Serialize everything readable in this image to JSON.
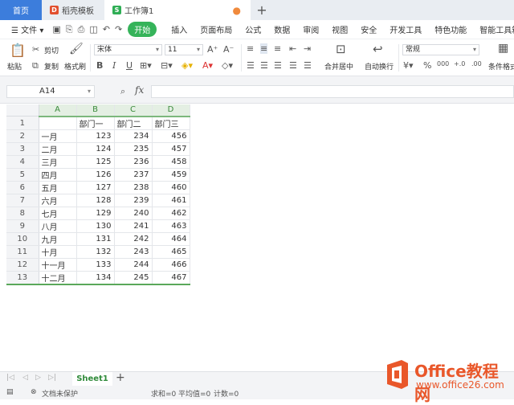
{
  "tabs": {
    "home": "首页",
    "template": "稻壳模板",
    "workbook": "工作簿1"
  },
  "menu": {
    "file": "文件",
    "start": "开始",
    "items": [
      "插入",
      "页面布局",
      "公式",
      "数据",
      "审阅",
      "视图",
      "安全",
      "开发工具",
      "特色功能",
      "智能工具箱"
    ]
  },
  "ribbon": {
    "paste": "粘贴",
    "cut": "剪切",
    "copy": "复制",
    "format_painter": "格式刷",
    "font": "宋体",
    "font_size": "11",
    "merge_center": "合并居中",
    "auto_wrap": "自动换行",
    "number_format": "常规",
    "conditional_format": "条件格式"
  },
  "formula_bar": {
    "cell_ref": "A14",
    "fx": "fx",
    "formula": ""
  },
  "sheet": {
    "columns": [
      "A",
      "B",
      "C",
      "D"
    ],
    "rows": [
      {
        "n": "1",
        "a": "",
        "b": "部门一",
        "c": "部门二",
        "d": "部门三"
      },
      {
        "n": "2",
        "a": "一月",
        "b": "123",
        "c": "234",
        "d": "456"
      },
      {
        "n": "3",
        "a": "二月",
        "b": "124",
        "c": "235",
        "d": "457"
      },
      {
        "n": "4",
        "a": "三月",
        "b": "125",
        "c": "236",
        "d": "458"
      },
      {
        "n": "5",
        "a": "四月",
        "b": "126",
        "c": "237",
        "d": "459"
      },
      {
        "n": "6",
        "a": "五月",
        "b": "127",
        "c": "238",
        "d": "460"
      },
      {
        "n": "7",
        "a": "六月",
        "b": "128",
        "c": "239",
        "d": "461"
      },
      {
        "n": "8",
        "a": "七月",
        "b": "129",
        "c": "240",
        "d": "462"
      },
      {
        "n": "9",
        "a": "八月",
        "b": "130",
        "c": "241",
        "d": "463"
      },
      {
        "n": "10",
        "a": "九月",
        "b": "131",
        "c": "242",
        "d": "464"
      },
      {
        "n": "11",
        "a": "十月",
        "b": "132",
        "c": "243",
        "d": "465"
      },
      {
        "n": "12",
        "a": "十一月",
        "b": "133",
        "c": "244",
        "d": "466"
      },
      {
        "n": "13",
        "a": "十二月",
        "b": "134",
        "c": "245",
        "d": "467"
      }
    ]
  },
  "sheet_tab": "Sheet1",
  "status": {
    "protect": "文档未保护",
    "sum": "求和=0",
    "avg": "平均值=0",
    "count": "计数=0"
  },
  "watermark": {
    "brand": "Office教程网",
    "url": "www.office26.com",
    "brand_color": "#e9572a"
  },
  "colors": {
    "accent_blue": "#3c7ddc",
    "accent_green": "#35b35a"
  }
}
